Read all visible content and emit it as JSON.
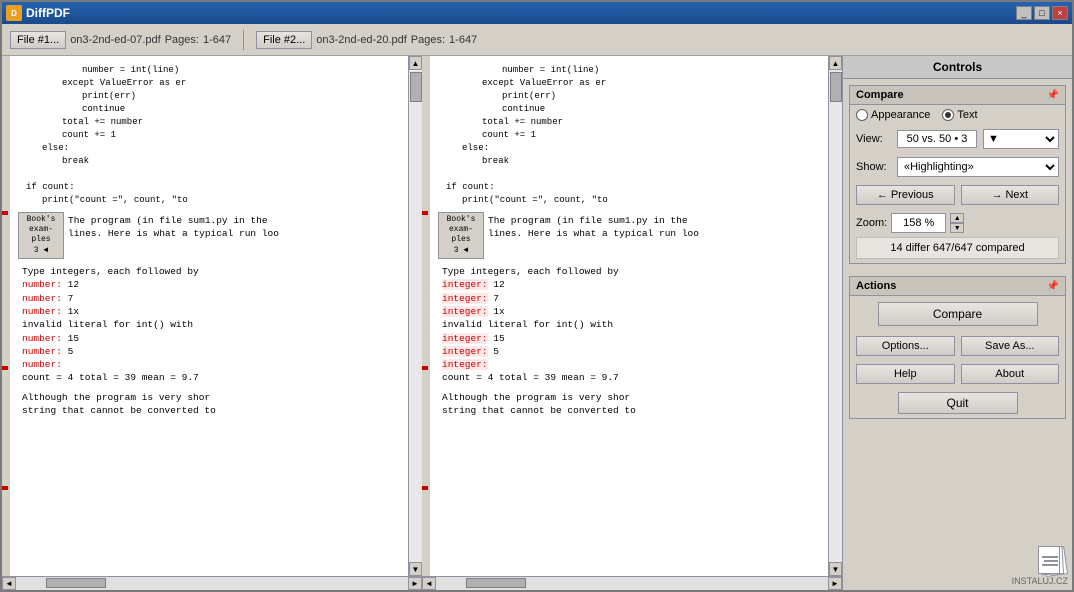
{
  "window": {
    "title": "DiffPDF",
    "titlebar_buttons": [
      "_",
      "□",
      "×"
    ]
  },
  "file1": {
    "label": "File #1...",
    "filename": "on3-2nd-ed-07.pdf",
    "pages_label": "Pages:",
    "pages": "1-647"
  },
  "file2": {
    "label": "File #2...",
    "filename": "on3-2nd-ed-20.pdf",
    "pages_label": "Pages:",
    "pages": "1-647"
  },
  "controls": {
    "title": "Controls",
    "compare_label": "Compare",
    "appearance_label": "Appearance",
    "text_label": "Text",
    "view_label": "View:",
    "view_value": "50 vs. 50 • 3",
    "show_label": "Show:",
    "show_value": "«Highlighting»",
    "previous_label": "Previous",
    "next_label": "Next",
    "zoom_label": "Zoom:",
    "zoom_value": "158 %",
    "differ_text": "14 differ 647/647 compared"
  },
  "actions": {
    "title": "Actions",
    "compare_button": "Compare",
    "options_button": "Options...",
    "save_as_button": "Save As...",
    "help_button": "Help",
    "about_button": "About",
    "quit_button": "Quit"
  },
  "pdf1": {
    "lines": [
      {
        "text": "number = int(line)",
        "indent": 2
      },
      {
        "text": "except ValueError as er",
        "indent": 1
      },
      {
        "text": "print(err)",
        "indent": 2
      },
      {
        "text": "continue",
        "indent": 2
      },
      {
        "text": "total += number",
        "indent": 1
      },
      {
        "text": "count += 1",
        "indent": 1
      },
      {
        "text": "else:",
        "indent": 0
      },
      {
        "text": "break",
        "indent": 1
      },
      {
        "text": "",
        "indent": 0
      },
      {
        "text": "if count:",
        "indent": 0
      },
      {
        "text": "print(\"count =\", count, \"to",
        "indent": 1
      }
    ],
    "book_tab": "Book's\nexam-\nples\n3 ◄",
    "body_text": "The program (in file sum1.py in the\nlines. Here is what a typical run loo",
    "type_text": "Type integers, each followed by",
    "entries": [
      {
        "label": "number:",
        "value": "12",
        "red": true
      },
      {
        "label": "number:",
        "value": "7",
        "red": true
      },
      {
        "label": "number:",
        "value": "1x",
        "red": true
      },
      {
        "label": "invalid literal for int() with",
        "red": false
      },
      {
        "label": "number:",
        "value": "15",
        "red": true
      },
      {
        "label": "number:",
        "value": "5",
        "red": true
      },
      {
        "label": "number:",
        "value": "",
        "red": true
      }
    ],
    "count_line": "count = 4 total = 39 mean = 9.7",
    "footer_text": "Although the program is very shor\nstring that cannot be converted to"
  },
  "pdf2": {
    "lines": [
      {
        "text": "number = int(line)",
        "indent": 2
      },
      {
        "text": "except ValueError as er",
        "indent": 1
      },
      {
        "text": "print(err)",
        "indent": 2
      },
      {
        "text": "continue",
        "indent": 2
      },
      {
        "text": "total += number",
        "indent": 1
      },
      {
        "text": "count += 1",
        "indent": 1
      },
      {
        "text": "else:",
        "indent": 0
      },
      {
        "text": "break",
        "indent": 1
      },
      {
        "text": "",
        "indent": 0
      },
      {
        "text": "if count:",
        "indent": 0
      },
      {
        "text": "print(\"count =\", count, \"to",
        "indent": 1
      }
    ],
    "book_tab": "Book's\nexam-\nples\n3 ◄",
    "body_text": "The program (in file sum1.py in the\nlines. Here is what a typical run loo",
    "type_text": "Type integers, each followed by",
    "entries": [
      {
        "label": "integer:",
        "value": "12",
        "red": true
      },
      {
        "label": "integer:",
        "value": "7",
        "red": true
      },
      {
        "label": "integer:",
        "value": "1x",
        "red": true
      },
      {
        "label": "invalid literal for int() with",
        "red": false
      },
      {
        "label": "integer:",
        "value": "15",
        "red": true
      },
      {
        "label": "integer:",
        "value": "5",
        "red": true
      },
      {
        "label": "integer:",
        "value": "",
        "red": true
      }
    ],
    "count_line": "count = 4 total = 39 mean = 9.7",
    "footer_text": "Although the program is very shor\nstring that cannot be converted to"
  },
  "logo": {
    "text": "INSTALUJ.CZ"
  }
}
